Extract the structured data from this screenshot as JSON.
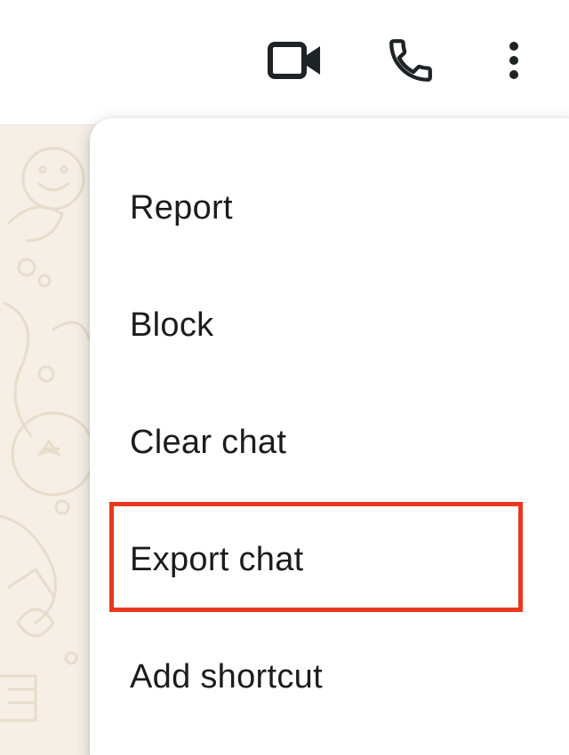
{
  "app_bar": {
    "icons": [
      "video-camera-icon",
      "phone-icon",
      "more-vert-icon"
    ]
  },
  "menu": {
    "items": [
      {
        "label": "Report"
      },
      {
        "label": "Block"
      },
      {
        "label": "Clear chat"
      },
      {
        "label": "Export chat",
        "highlighted": true
      },
      {
        "label": "Add shortcut"
      }
    ]
  },
  "colors": {
    "icon": "#1e2326",
    "wallpaper": "#f5efe6",
    "wallpaper_doodle": "#e8dccb",
    "highlight": "#e8381f",
    "menu_text": "#1c1c1c"
  }
}
